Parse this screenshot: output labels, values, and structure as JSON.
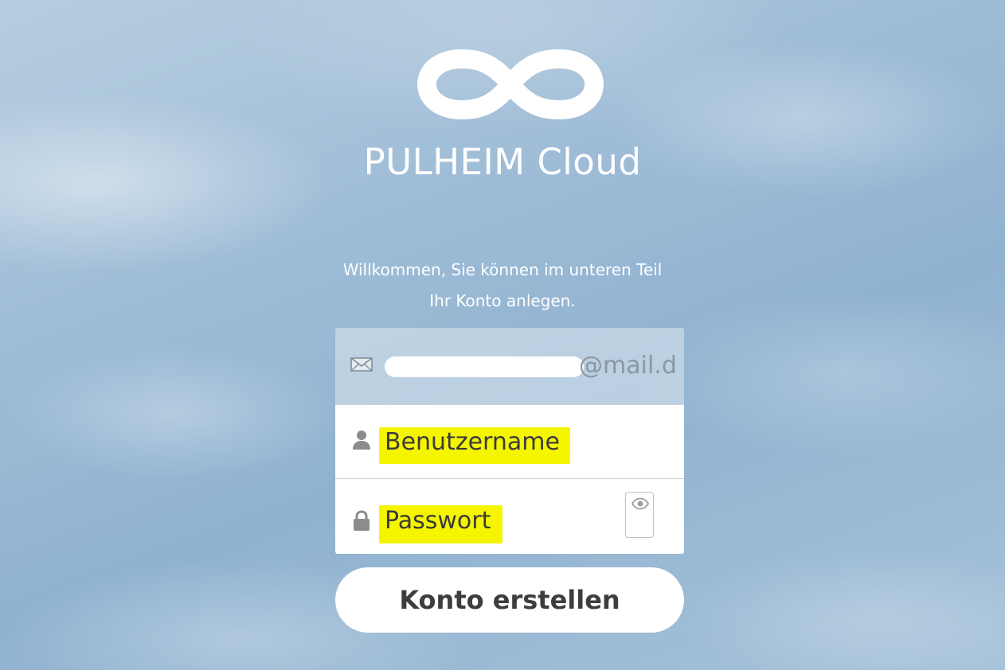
{
  "brand": {
    "logo_icon": "infinity-icon",
    "name": "PULHEIM Cloud"
  },
  "welcome": {
    "line1": "Willkommen, Sie können im unteren Teil",
    "line2": "Ihr Konto anlegen."
  },
  "form": {
    "email": {
      "icon": "envelope-icon",
      "visible_value": "@mail.d"
    },
    "username": {
      "icon": "user-icon",
      "placeholder": "Benutzername"
    },
    "password": {
      "icon": "lock-icon",
      "placeholder": "Passwort",
      "toggle_icon": "eye-icon"
    },
    "submit_label": "Konto erstellen"
  },
  "colors": {
    "highlight": "#f5f500",
    "background": "#9ebcd6",
    "text_light": "#ffffff"
  }
}
